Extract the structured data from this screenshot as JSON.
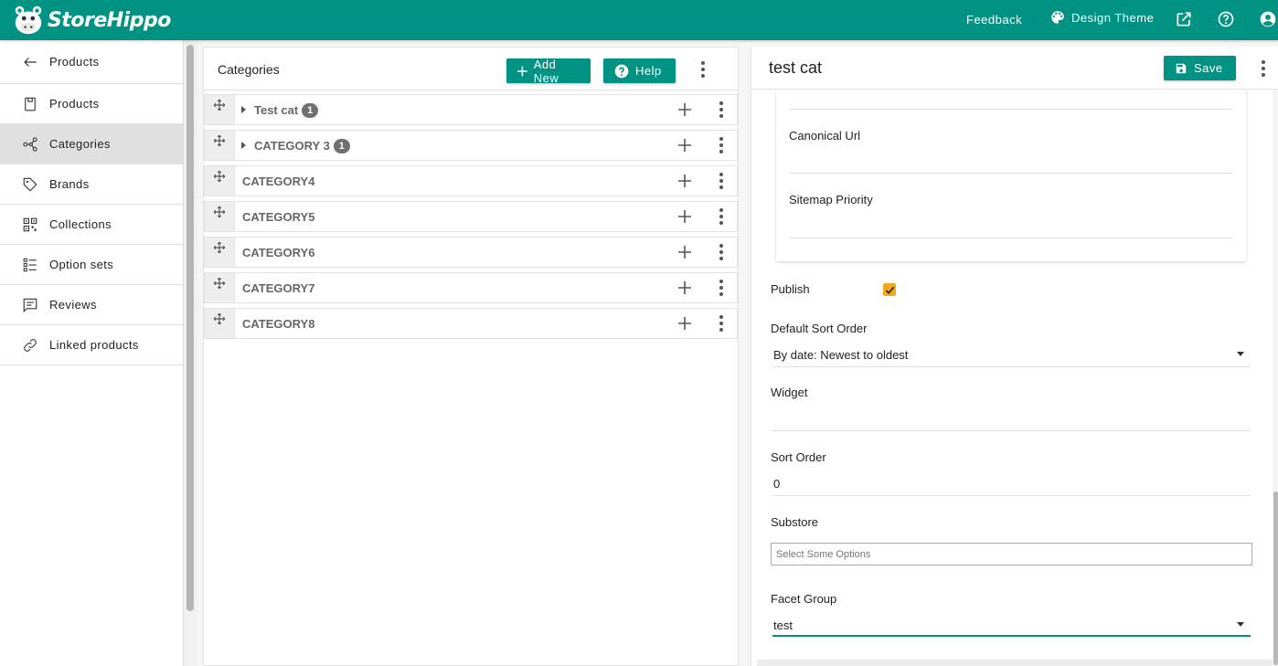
{
  "brand": {
    "name": "StoreHippo",
    "accent": "#009282",
    "checkbox_color": "#f5a623"
  },
  "topnav": {
    "feedback": "Feedback",
    "design_theme": "Design Theme"
  },
  "sidebar": {
    "back_label": "Products",
    "items": [
      {
        "label": "Products",
        "icon": "product-box-icon",
        "active": false
      },
      {
        "label": "Categories",
        "icon": "categories-tree-icon",
        "active": true
      },
      {
        "label": "Brands",
        "icon": "tag-icon",
        "active": false
      },
      {
        "label": "Collections",
        "icon": "grid-collection-icon",
        "active": false
      },
      {
        "label": "Option sets",
        "icon": "list-options-icon",
        "active": false
      },
      {
        "label": "Reviews",
        "icon": "comment-icon",
        "active": false
      },
      {
        "label": "Linked products",
        "icon": "link-icon",
        "active": false
      }
    ]
  },
  "categories": {
    "title": "Categories",
    "add_new": "Add New",
    "help": "Help",
    "rows": [
      {
        "name": "Test cat",
        "badge": "1"
      },
      {
        "name": "CATEGORY 3",
        "badge": "1"
      },
      {
        "name": "CATEGORY4"
      },
      {
        "name": "CATEGORY5"
      },
      {
        "name": "CATEGORY6"
      },
      {
        "name": "CATEGORY7"
      },
      {
        "name": "CATEGORY8"
      }
    ]
  },
  "detail": {
    "title": "test cat",
    "save": "Save",
    "seo": {
      "canonical_url_label": "Canonical Url",
      "sitemap_priority_label": "Sitemap Priority"
    },
    "publish_label": "Publish",
    "publish_checked": true,
    "default_sort_order_label": "Default Sort Order",
    "default_sort_order_value": "By date: Newest to oldest",
    "widget_label": "Widget",
    "sort_order_label": "Sort Order",
    "sort_order_value": "0",
    "substore_label": "Substore",
    "substore_placeholder": "Select Some Options",
    "facet_group_label": "Facet Group",
    "facet_group_value": "test"
  }
}
